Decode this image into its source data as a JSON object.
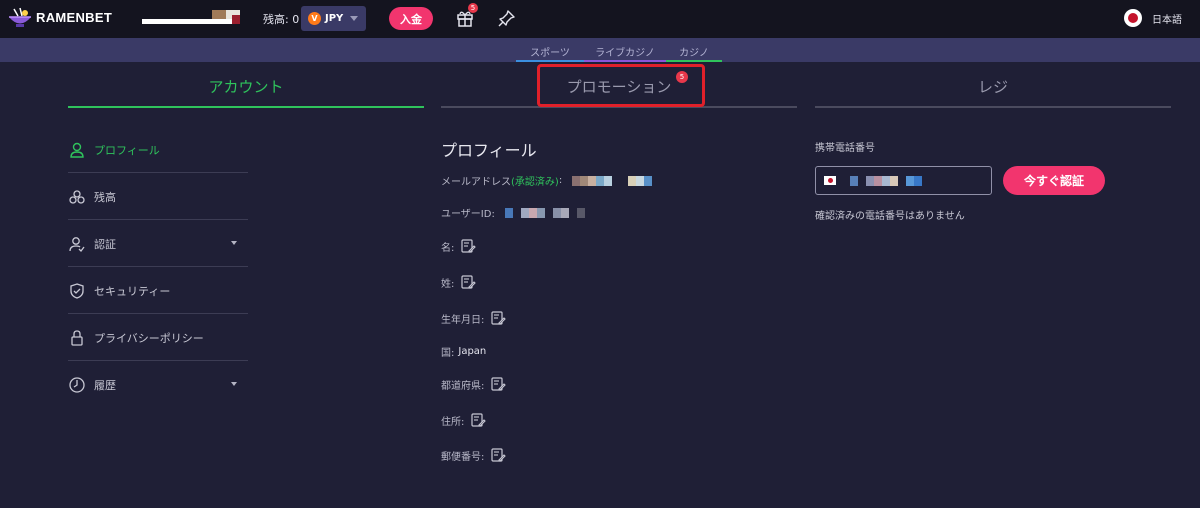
{
  "topbar": {
    "logo_text": "RAMENBET",
    "balance_label": "残高: 0",
    "currency": "JPY",
    "currency_icon": "V",
    "deposit_label": "入金",
    "gift_badge": "5",
    "language": "日本語"
  },
  "nav": {
    "items": [
      {
        "label": "スポーツ",
        "underline": "#3b8fe0"
      },
      {
        "label": "ライブカジノ",
        "underline": "#8a55d8"
      },
      {
        "label": "カジノ",
        "underline": "#2fc35c"
      }
    ]
  },
  "tabs": {
    "account": "アカウント",
    "promotion": "プロモーション",
    "promotion_badge": "5",
    "register": "レジ"
  },
  "sidebar": {
    "items": [
      {
        "label": "プロフィール",
        "icon": "user-icon",
        "active": true
      },
      {
        "label": "残高",
        "icon": "coins-icon"
      },
      {
        "label": "認証",
        "icon": "verification-icon",
        "dropdown": true
      },
      {
        "label": "セキュリティー",
        "icon": "shield-icon"
      },
      {
        "label": "プライバシーポリシー",
        "icon": "lock-icon"
      },
      {
        "label": "履歴",
        "icon": "history-icon",
        "dropdown": true
      }
    ]
  },
  "profile": {
    "title": "プロフィール",
    "email_label": "メールアドレス ",
    "email_status": "(承認済み)",
    "email_colon": ":",
    "userid_label": "ユーザーID:",
    "first_name_label": "名:",
    "last_name_label": "姓:",
    "birthdate_label": "生年月日:",
    "country_label": "国:",
    "country_value": "Japan",
    "prefecture_label": "都道府県:",
    "address_label": "住所:",
    "postal_label": "郵便番号:"
  },
  "register": {
    "phone_label": "携帯電話番号",
    "verify_button": "今すぐ認証",
    "no_phone_text": "確認済みの電話番号はありません"
  },
  "colors": {
    "accent_green": "#2fc35c",
    "accent_pink": "#f2356e",
    "highlight_red": "#e0202a"
  }
}
